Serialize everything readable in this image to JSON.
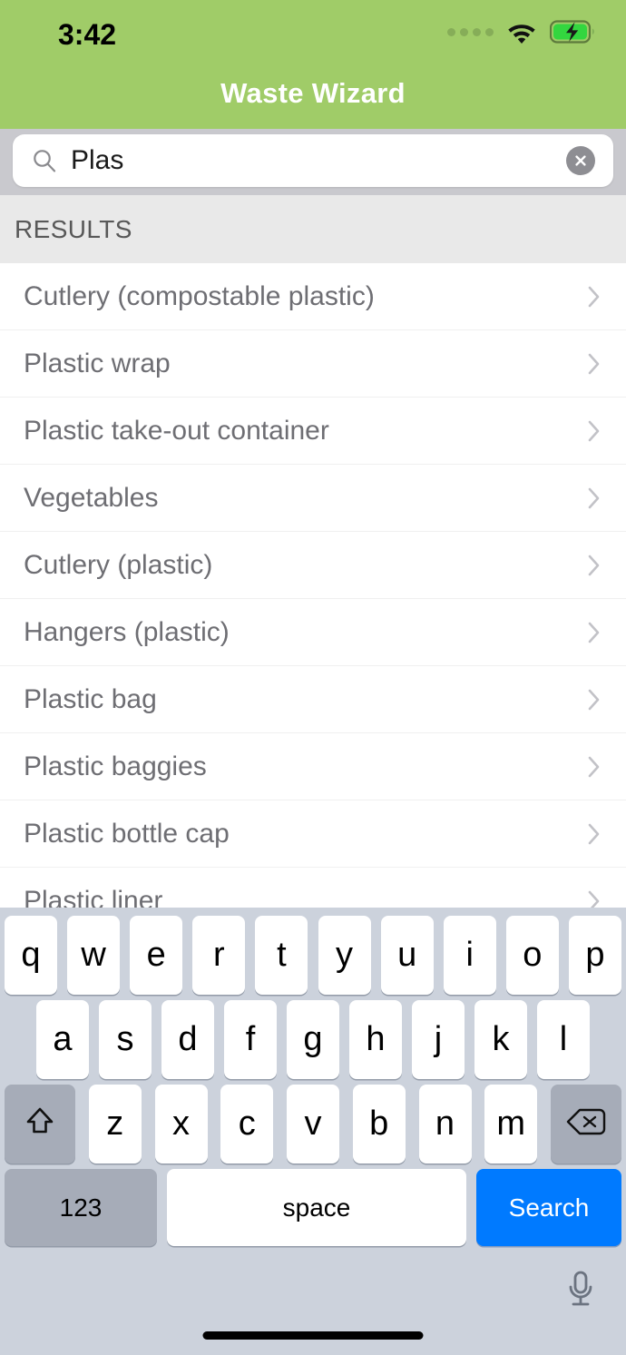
{
  "status_bar": {
    "time": "3:42",
    "signal_dots": 4,
    "wifi_icon": "wifi-icon",
    "battery_icon": "battery-charging-icon",
    "battery_charging": true
  },
  "header": {
    "title": "Waste Wizard",
    "background_color": "#a0cc68",
    "title_color": "#ffffff"
  },
  "search": {
    "icon": "search-icon",
    "value": "Plas",
    "placeholder": "Search",
    "clear_icon": "close-circle-icon"
  },
  "results": {
    "section_header": "RESULTS",
    "items": [
      {
        "label": "Cutlery (compostable plastic)",
        "accessory": "chevron-right-icon"
      },
      {
        "label": "Plastic wrap",
        "accessory": "chevron-right-icon"
      },
      {
        "label": "Plastic take-out container",
        "accessory": "chevron-right-icon"
      },
      {
        "label": "Vegetables",
        "accessory": "chevron-right-icon"
      },
      {
        "label": "Cutlery (plastic)",
        "accessory": "chevron-right-icon"
      },
      {
        "label": "Hangers (plastic)",
        "accessory": "chevron-right-icon"
      },
      {
        "label": "Plastic bag",
        "accessory": "chevron-right-icon"
      },
      {
        "label": "Plastic baggies",
        "accessory": "chevron-right-icon"
      },
      {
        "label": "Plastic bottle cap",
        "accessory": "chevron-right-icon"
      },
      {
        "label": "Plastic liner",
        "accessory": "chevron-right-icon"
      }
    ]
  },
  "keyboard": {
    "row1": [
      "q",
      "w",
      "e",
      "r",
      "t",
      "y",
      "u",
      "i",
      "o",
      "p"
    ],
    "row2": [
      "a",
      "s",
      "d",
      "f",
      "g",
      "h",
      "j",
      "k",
      "l"
    ],
    "row3": [
      "z",
      "x",
      "c",
      "v",
      "b",
      "n",
      "m"
    ],
    "shift_icon": "shift-up-arrow-icon",
    "backspace_icon": "backspace-delete-icon",
    "numbers_label": "123",
    "space_label": "space",
    "return_label": "Search",
    "return_color": "#007aff",
    "mic_icon": "microphone-icon",
    "background_color": "#ccd2dc"
  }
}
